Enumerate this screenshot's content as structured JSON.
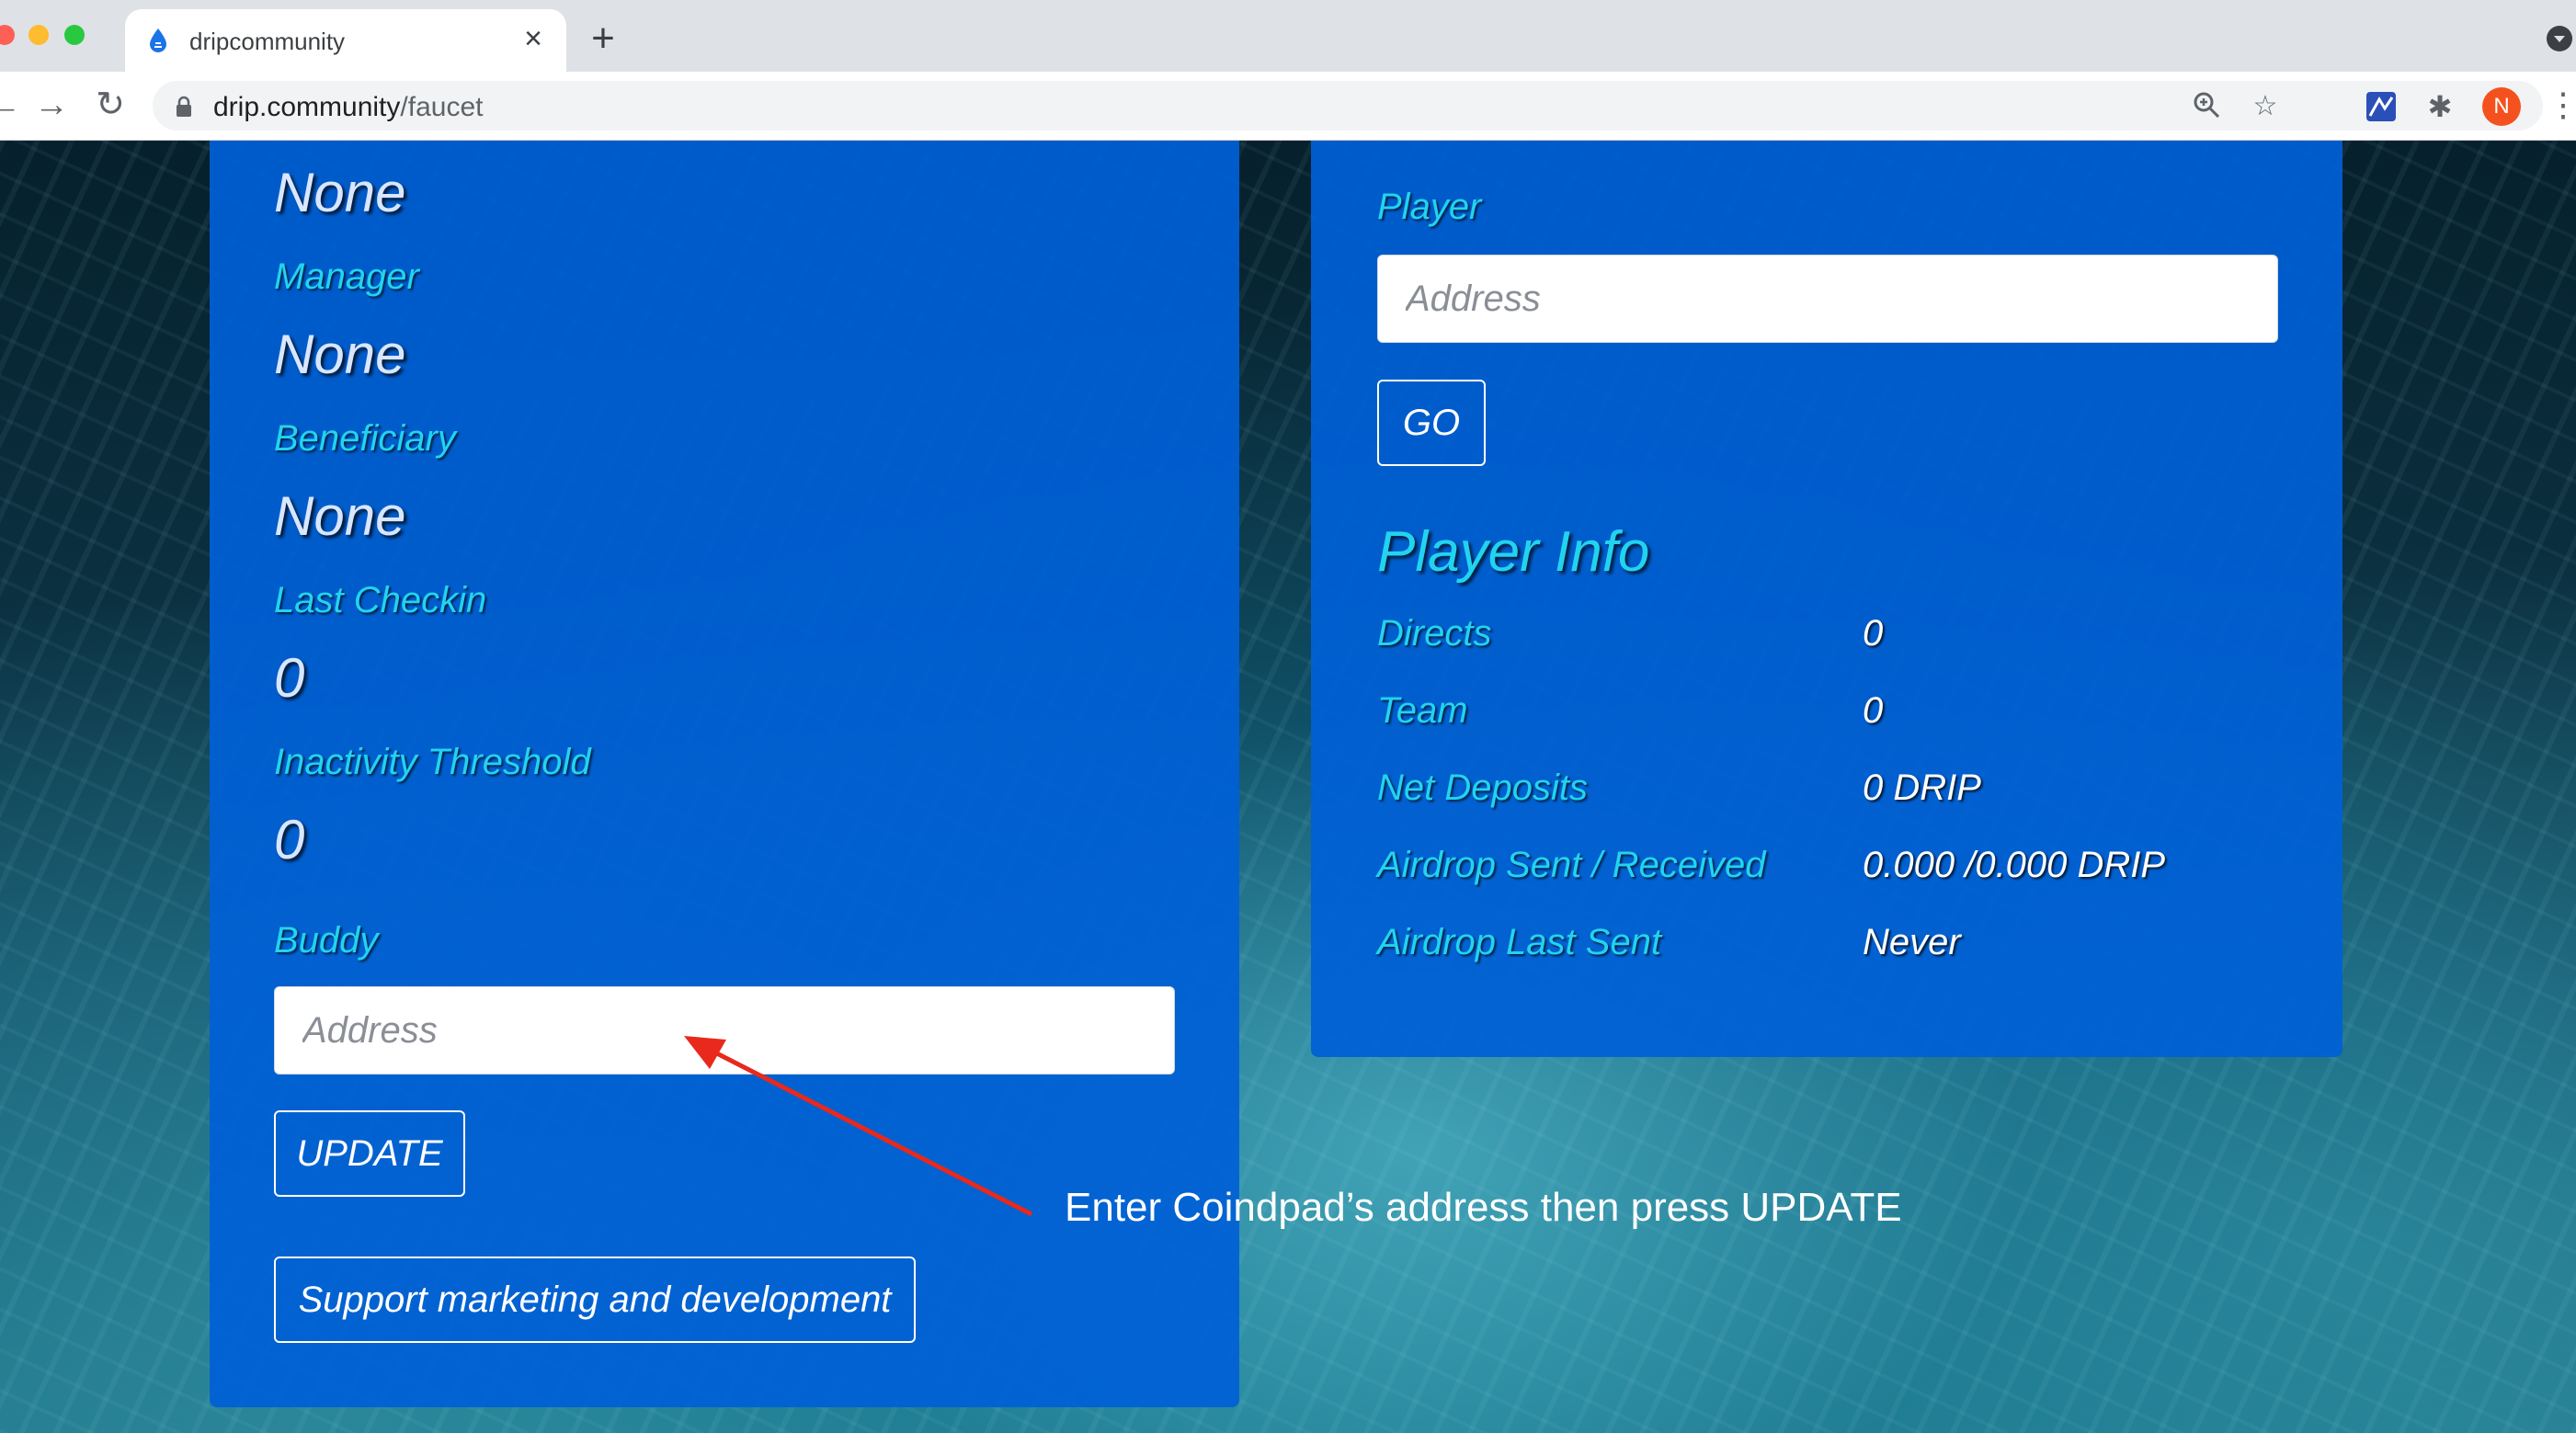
{
  "browser": {
    "tab_title": "dripcommunity",
    "tab_close": "×",
    "new_tab": "+",
    "url_host": "drip.community",
    "url_path": "/faucet",
    "avatar_initial": "N",
    "icons": {
      "favicon": "drip-icon",
      "back": "back-arrow-icon",
      "forward": "forward-arrow-icon",
      "reload": "reload-icon",
      "lock": "lock-icon",
      "zoom": "zoom-icon",
      "bookmark": "star-icon",
      "extension": "extension-icon",
      "puzzle": "puzzle-icon",
      "menu": "kebab-menu-icon"
    }
  },
  "left_card": {
    "top_value": "None",
    "manager_label": "Manager",
    "manager_value": "None",
    "beneficiary_label": "Beneficiary",
    "beneficiary_value": "None",
    "last_checkin_label": "Last Checkin",
    "last_checkin_value": "0",
    "inactivity_label": "Inactivity Threshold",
    "inactivity_value": "0",
    "buddy_label": "Buddy",
    "buddy_placeholder": "Address",
    "update_button": "UPDATE",
    "support_button": "Support marketing and development"
  },
  "right_card": {
    "player_label": "Player",
    "player_placeholder": "Address",
    "go_button": "GO",
    "player_info_heading": "Player Info",
    "info_rows": [
      {
        "label": "Directs",
        "value": "0"
      },
      {
        "label": "Team",
        "value": "0"
      },
      {
        "label": "Net Deposits",
        "value": "0 DRIP"
      },
      {
        "label": "Airdrop Sent / Received",
        "value": "0.000 /0.000 DRIP"
      },
      {
        "label": "Airdrop Last Sent",
        "value": "Never"
      }
    ]
  },
  "annotation": {
    "text": "Enter Coindpad’s address then press UPDATE",
    "arrow_color": "#e8291c"
  },
  "colors": {
    "card": "#0060d6",
    "label": "#22d3f0",
    "chrome_bg": "#dee1e6"
  }
}
